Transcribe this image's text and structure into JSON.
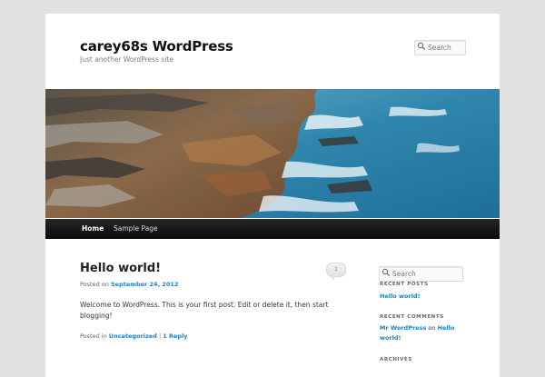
{
  "header": {
    "title": "carey68s WordPress",
    "description": "Just another WordPress site",
    "search_placeholder": "Search"
  },
  "nav": {
    "items": [
      {
        "label": "Home",
        "active": true
      },
      {
        "label": "Sample Page",
        "active": false
      }
    ]
  },
  "post": {
    "title": "Hello world!",
    "comment_count": "1",
    "posted_on_prefix": "Posted on",
    "date": "September 24, 2012",
    "content": "Welcome to WordPress. This is your first post. Edit or delete it, then start blogging!",
    "posted_in_prefix": "Posted in",
    "category": "Uncategorized",
    "separator": "|",
    "reply_link": "1 Reply"
  },
  "sidebar": {
    "search_placeholder": "Search",
    "recent_posts_title": "RECENT POSTS",
    "recent_posts": [
      "Hello world!"
    ],
    "recent_comments_title": "RECENT COMMENTS",
    "recent_comment": {
      "author": "Mr WordPress",
      "on": "on",
      "post": "Hello world!"
    },
    "archives_title": "ARCHIVES"
  },
  "colors": {
    "link": "#1982d1",
    "background": "#e2e2e2",
    "nav_background": "#111111"
  },
  "icons": {
    "search": "magnifier-icon"
  }
}
